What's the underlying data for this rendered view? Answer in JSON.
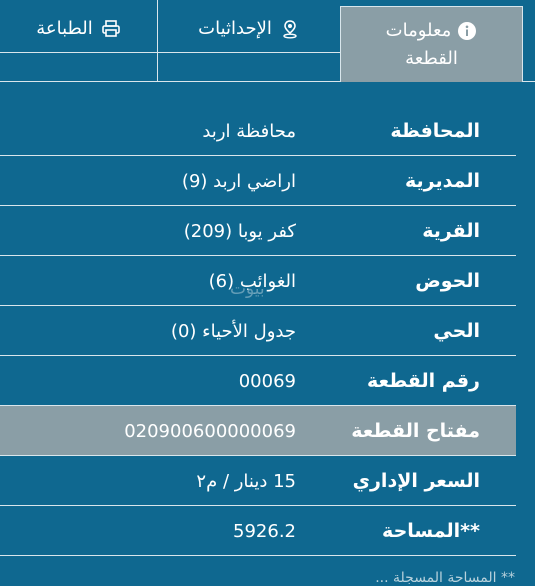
{
  "tabs": {
    "info": {
      "line1": "معلومات",
      "line2": "القطعة",
      "icon": "info-icon"
    },
    "coords": {
      "label": "الإحداثيات",
      "icon": "location-pin-icon"
    },
    "print": {
      "label": "الطباعة",
      "icon": "printer-icon"
    }
  },
  "rows": [
    {
      "label": "المحافظة",
      "value": "محافظة اربد"
    },
    {
      "label": "المديرية",
      "value": "اراضي اربد (9)"
    },
    {
      "label": "القرية",
      "value": "كفر يوبا (209)"
    },
    {
      "label": "الحوض",
      "value": "الغوائب (6)"
    },
    {
      "label": "الحي",
      "value": "جدول الأحياء (0)"
    },
    {
      "label": "رقم القطعة",
      "value": "00069"
    },
    {
      "label": "مفتاح القطعة",
      "value": "020900600000069"
    },
    {
      "label": "السعر الإداري",
      "value": "15 دينار / م٢"
    },
    {
      "label": "**المساحة",
      "value": "5926.2"
    }
  ],
  "watermark": "بيوت",
  "footer": "** المساحة المسجلة ..."
}
